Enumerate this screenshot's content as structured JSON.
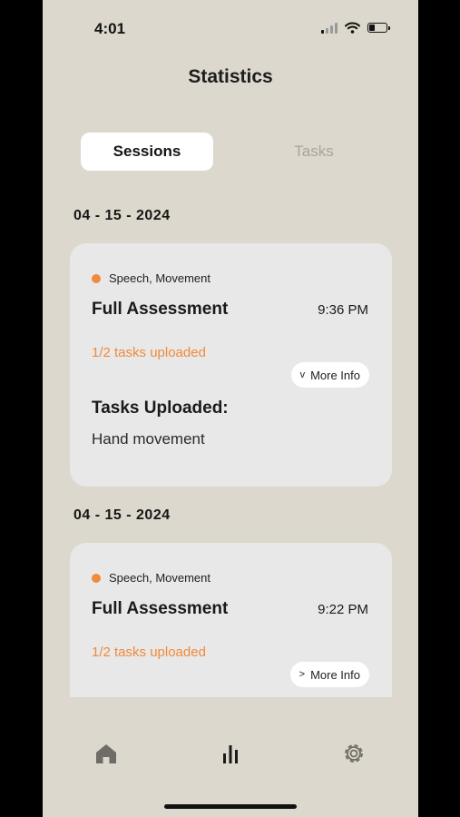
{
  "status_bar": {
    "time": "4:01",
    "battery_level": 0.35,
    "signal_bars_active": 1,
    "signal_bars_total": 4
  },
  "header": {
    "title": "Statistics"
  },
  "tabs": [
    {
      "label": "Sessions",
      "active": true
    },
    {
      "label": "Tasks",
      "active": false
    }
  ],
  "sessions": [
    {
      "date": "04 - 15 - 2024",
      "tags": "Speech, Movement",
      "title": "Full Assessment",
      "time": "9:36 PM",
      "progress": "1/2 tasks uploaded",
      "more_info_label": "More Info",
      "more_info_chevron": "v",
      "expanded": true,
      "uploaded_heading": "Tasks Uploaded:",
      "uploaded_items": [
        "Hand movement"
      ]
    },
    {
      "date": "04 - 15 - 2024",
      "tags": "Speech, Movement",
      "title": "Full Assessment",
      "time": "9:22 PM",
      "progress": "1/2 tasks uploaded",
      "more_info_label": "More Info",
      "more_info_chevron": ">",
      "expanded": false
    }
  ],
  "bottom_nav": [
    {
      "icon": "home-icon",
      "active": false
    },
    {
      "icon": "bar-chart-icon",
      "active": true
    },
    {
      "icon": "gear-icon",
      "active": false
    }
  ],
  "colors": {
    "background": "#dcd8cd",
    "card": "#e8e8e8",
    "accent": "#f08a3c",
    "inactive_tab": "#a7a49d"
  }
}
